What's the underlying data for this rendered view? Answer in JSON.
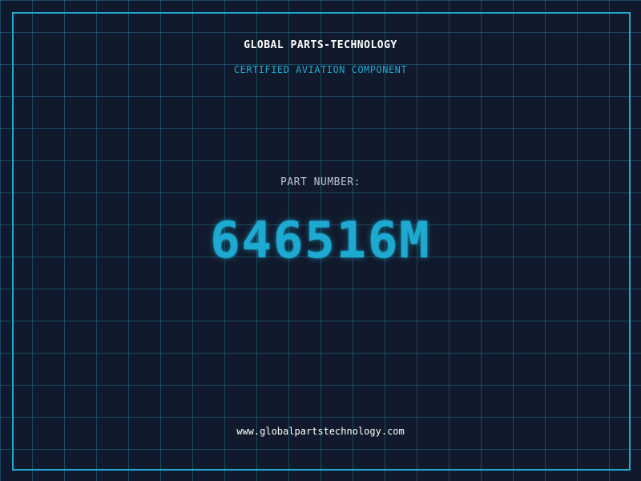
{
  "header": {
    "company_name": "GLOBAL PARTS-TECHNOLOGY",
    "subtitle": "CERTIFIED AVIATION COMPONENT"
  },
  "part": {
    "label": "PART NUMBER:",
    "number": "646516M"
  },
  "footer": {
    "website": "www.globalpartstechnology.com"
  },
  "colors": {
    "background": "#111a2c",
    "accent": "#1eaad0",
    "grid": "#1f6f8a",
    "text_primary": "#ffffff",
    "text_secondary": "#b9c4d2"
  }
}
